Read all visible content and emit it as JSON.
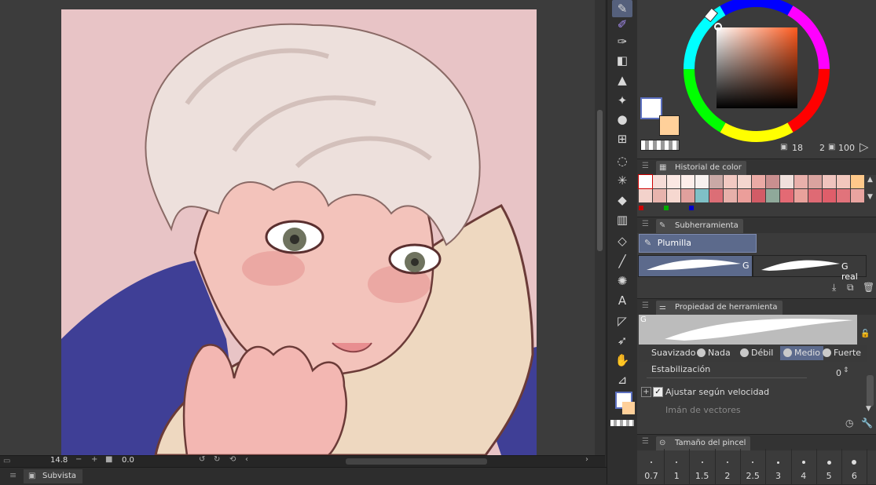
{
  "canvas": {
    "zoom": "14.8",
    "rotation": "0.0"
  },
  "subview": {
    "label": "Subvista"
  },
  "toolbar": {
    "tools": [
      "pen-icon",
      "brush-icon",
      "airbrush-icon",
      "eraser-icon",
      "blend-icon",
      "decoration-icon",
      "fill-drop-icon",
      "grid-icon",
      "lasso-icon",
      "magic-wand-icon",
      "bucket-icon",
      "gradient-icon",
      "3d-cube-icon",
      "line-icon",
      "burst-icon",
      "text-icon",
      "ruler-icon",
      "object-select-icon",
      "hand-icon",
      "eyedropper-icon"
    ]
  },
  "color_wheel": {
    "size": "18",
    "opacity_a": "2",
    "opacity_b": "100",
    "main_color": "#ffffff",
    "sub_color": "#ffd09a"
  },
  "color_history": {
    "title": "Historial de color",
    "row1": [
      "#ffffff",
      "#f6dcd7",
      "#fbe8e3",
      "#fdeeea",
      "#f7f1ef",
      "#c9a9a6",
      "#f2c9c2",
      "#f4d6cf",
      "#ebaaa5",
      "#c98f8f",
      "#f0e0dc",
      "#e9b0ab",
      "#d9a39f",
      "#f0c4be",
      "#f2c7bd",
      "#ffc88a"
    ],
    "row2": [
      "#f3d2cb",
      "#e8b4ad",
      "#f6d8d0",
      "#e1a09d",
      "#7fc0c6",
      "#dc6e76",
      "#e7b0aa",
      "#eb9e9a",
      "#d25c66",
      "#8fa99a",
      "#e36a74",
      "#e9a19b",
      "#df6a74",
      "#df5e6a",
      "#e1737b",
      "#e9a4a0"
    ]
  },
  "subtool": {
    "title": "Subherramienta",
    "selected": "Plumilla",
    "brush_a_badge": "G",
    "brush_b_label": "G real"
  },
  "tool_property": {
    "title": "Propiedad de herramienta",
    "preview_badge": "G",
    "smoothing_label": "Suavizado",
    "options": [
      "Nada",
      "Débil",
      "Medio",
      "Fuerte"
    ],
    "selected_option": "Medio",
    "stabilization_label": "Estabilización",
    "stabilization_value": "0",
    "adjust_speed_label": "Ajustar según velocidad",
    "vector_magnet_label": "Imán de vectores"
  },
  "brush_size": {
    "title": "Tamaño del pincel",
    "sizes": [
      "0.7",
      "1",
      "1.5",
      "2",
      "2.5",
      "3",
      "4",
      "5",
      "6"
    ]
  }
}
